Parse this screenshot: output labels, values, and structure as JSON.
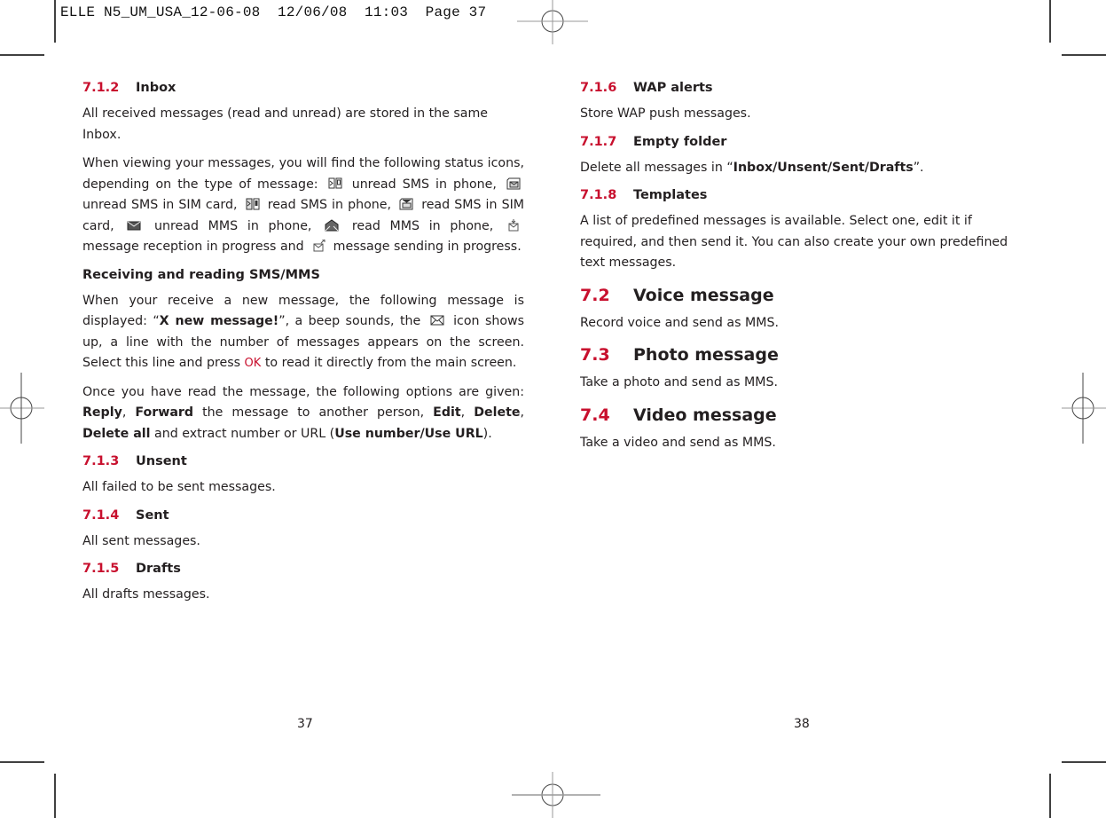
{
  "slug": "ELLE N5_UM_USA_12-06-08  12/06/08  11:03  Page 37",
  "left_page": {
    "page_number": "37",
    "inbox": {
      "num": "7.1.2",
      "title": "Inbox",
      "p1": "All received messages (read and unread) are stored in the same Inbox.",
      "p2_a": "When viewing your messages, you will find the following status icons, depending on the type of message:",
      "p2_icon1_label": "unread SMS in phone,",
      "p2_icon2_label": "unread SMS in SIM card,",
      "p2_icon3_label": "read SMS in phone,",
      "p2_icon4_label": "read SMS in SIM card,",
      "p2_icon5_label": "unread MMS in phone,",
      "p2_icon6_label": "read MMS in phone,",
      "p2_icon7_label": "message reception in progress and",
      "p2_icon8_label": "message sending in progress."
    },
    "receiving": {
      "title": "Receiving and reading SMS/MMS",
      "p1_a": "When your receive a new message, the following message is displayed: “",
      "p1_bold": "X new message!",
      "p1_b": "”, a beep sounds, the",
      "p1_c": "icon shows up, a line with the number of messages appears on the screen. Select this line and press",
      "ok_key": "OK",
      "p1_d": "to read it directly from the main screen.",
      "p2_a": "Once you have read the message, the following options are given:",
      "opt_reply": "Reply",
      "opt_forward": "Forward",
      "p2_b": "the message to another person,",
      "opt_edit": "Edit",
      "opt_delete": "Delete",
      "opt_delete_all": "Delete all",
      "p2_c": "and extract number or URL (",
      "opt_use": "Use number/Use URL",
      "p2_d": ")."
    },
    "unsent": {
      "num": "7.1.3",
      "title": "Unsent",
      "text": "All failed to be sent messages."
    },
    "sent": {
      "num": "7.1.4",
      "title": "Sent",
      "text": "All sent messages."
    },
    "drafts": {
      "num": "7.1.5",
      "title": "Drafts",
      "text": "All drafts messages."
    }
  },
  "right_page": {
    "page_number": "38",
    "wap": {
      "num": "7.1.6",
      "title": "WAP alerts",
      "text": "Store WAP push messages."
    },
    "empty": {
      "num": "7.1.7",
      "title": "Empty folder",
      "text_a": "Delete all messages in “",
      "text_bold": "Inbox/Unsent/Sent/Drafts",
      "text_b": "”."
    },
    "templates": {
      "num": "7.1.8",
      "title": "Templates",
      "text": "A list of predefined messages is available. Select one, edit it if required, and then send it. You can also create your own predefined text messages."
    },
    "voice": {
      "num": "7.2",
      "title": "Voice message",
      "text": "Record voice and send as MMS."
    },
    "photo": {
      "num": "7.3",
      "title": "Photo message",
      "text": "Take a photo and send as MMS."
    },
    "video": {
      "num": "7.4",
      "title": "Video message",
      "text": "Take a video and send as MMS."
    }
  },
  "colors": {
    "accent": "#c8102e",
    "text": "#231f20"
  }
}
